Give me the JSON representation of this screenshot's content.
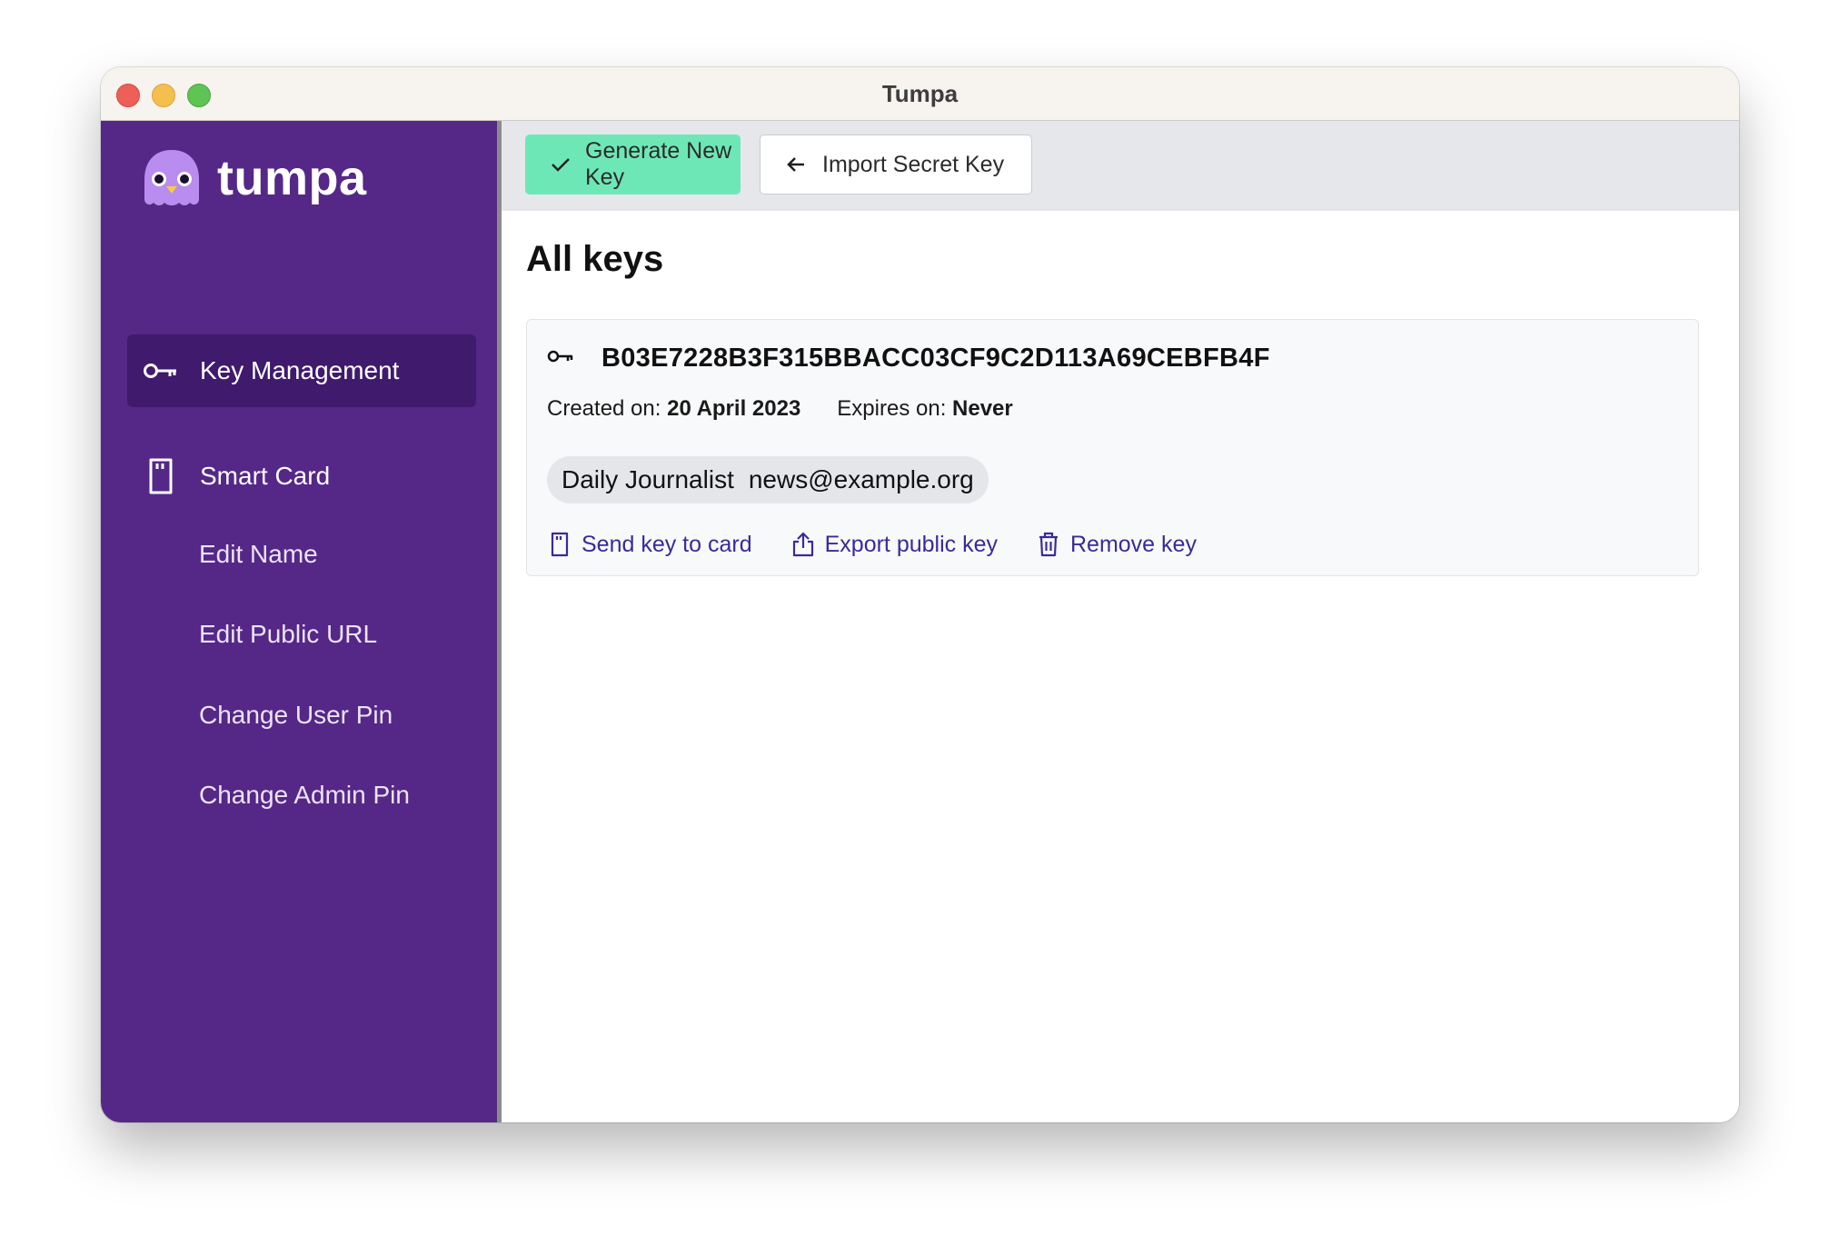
{
  "window": {
    "title": "Tumpa"
  },
  "sidebar": {
    "logo_text": "tumpa",
    "items": [
      {
        "label": "Key Management",
        "icon": "key-icon",
        "active": true
      },
      {
        "label": "Smart Card",
        "icon": "smart-card-icon",
        "active": false
      }
    ],
    "sub_items": [
      {
        "label": "Edit Name"
      },
      {
        "label": "Edit Public URL"
      },
      {
        "label": "Change User Pin"
      },
      {
        "label": "Change Admin Pin"
      }
    ]
  },
  "toolbar": {
    "generate_label": "Generate New Key",
    "generate_icon": "check-icon",
    "import_label": "Import Secret Key",
    "import_icon": "arrow-left-icon"
  },
  "main": {
    "heading": "All keys",
    "keys": [
      {
        "fingerprint": "B03E7228B3F315BBACC03CF9C2D113A69CEBFB4F",
        "created_label": "Created on:",
        "created_value": "20 April 2023",
        "expires_label": "Expires on:",
        "expires_value": "Never",
        "uid_name": "Daily Journalist",
        "uid_email": "news@example.org",
        "actions": [
          {
            "label": "Send key to card",
            "icon": "smart-card-icon"
          },
          {
            "label": "Export public key",
            "icon": "share-icon"
          },
          {
            "label": "Remove key",
            "icon": "trash-icon"
          }
        ]
      }
    ]
  },
  "colors": {
    "sidebar_bg": "#552887",
    "sidebar_active": "#3f1a6d",
    "generate_btn": "#6ee7b7",
    "action_link": "#3b2a98",
    "toolbar_bg": "#e5e7eb"
  }
}
